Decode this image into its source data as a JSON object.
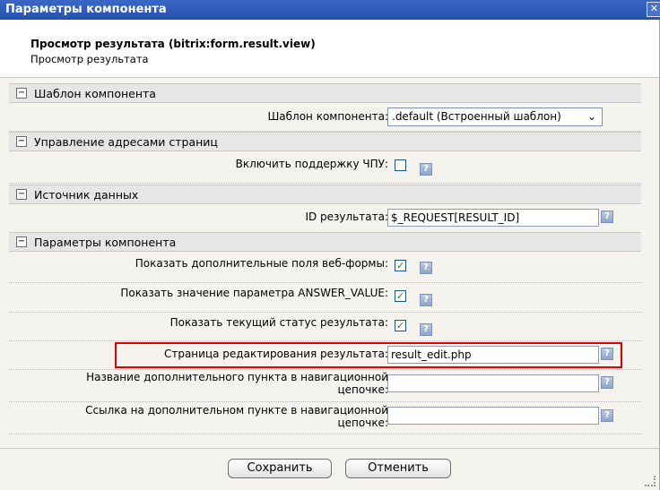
{
  "dialog": {
    "title": "Параметры компонента",
    "close_icon": "close-icon"
  },
  "header": {
    "title": "Просмотр результата (bitrix:form.result.view)",
    "subtitle": "Просмотр результата"
  },
  "sections": {
    "template": {
      "label": "Шаблон компонента",
      "toggle": "−",
      "template_label": "Шаблон компонента:",
      "template_value": ".default (Встроенный шаблон)",
      "arrow": "⌄"
    },
    "sef": {
      "label": "Управление адресами страниц",
      "toggle": "−",
      "sef_label": "Включить поддержку ЧПУ:"
    },
    "data": {
      "label": "Источник данных",
      "toggle": "−",
      "id_label": "ID результата:",
      "id_value": "$_REQUEST[RESULT_ID]"
    },
    "params": {
      "label": "Параметры компонента",
      "toggle": "−",
      "rows": [
        {
          "label": "Показать дополнительные поля веб-формы:",
          "checked": "✓"
        },
        {
          "label": "Показать значение параметра ANSWER_VALUE:",
          "checked": "✓"
        },
        {
          "label": "Показать текущий статус результата:",
          "checked": "✓"
        }
      ],
      "edit_page_label": "Страница редактирования результата:",
      "edit_page_value": "result_edit.php",
      "chain_name_label_1": "Название дополнительного пункта в навигационной",
      "chain_name_label_2": "цепочке:",
      "chain_name_value": "",
      "chain_link_label_1": "Ссылка на дополнительном пункте в навигационной",
      "chain_link_label_2": "цепочке:",
      "chain_link_value": ""
    }
  },
  "help_text": "?",
  "buttons": {
    "save": "Сохранить",
    "cancel": "Отменить"
  },
  "colors": {
    "titlebar": "#2f5cbb",
    "highlight": "#e00000",
    "section_bg": "#e6e6e6"
  }
}
